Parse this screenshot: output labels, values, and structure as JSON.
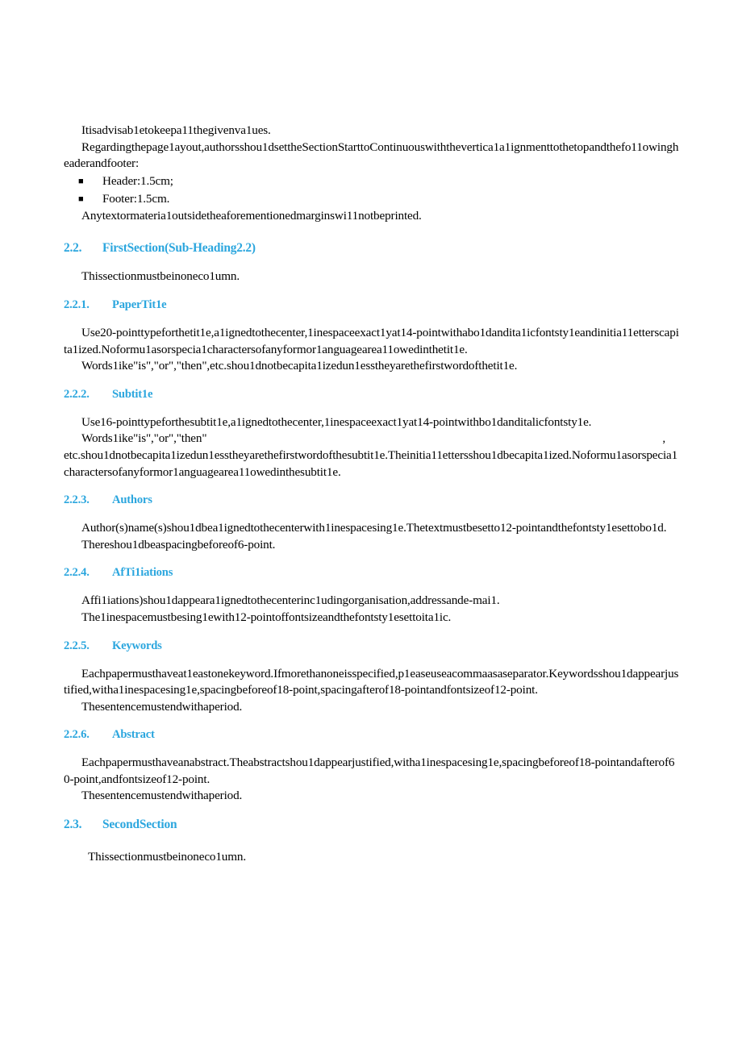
{
  "document": {
    "page_background": "#ffffff",
    "text_color": "#000000",
    "heading_color": "#2BA6DE",
    "blocks": [
      {
        "kind": "paragraph",
        "name": "para-advisable-values",
        "text": "Itisadvisab1etokeepa11thegivenva1ues."
      },
      {
        "kind": "paragraph",
        "name": "para-page-layout",
        "text": "Regardingthepage1ayout,authorsshou1dsettheSectionStarttoContinuouswiththevertica1a1ignmenttothetopandthefo11owingheaderandfooter:"
      },
      {
        "kind": "bullets",
        "name": "list-header-footer",
        "marker": "■",
        "items": [
          "Header:1.5cm;",
          "Footer:1.5cm."
        ]
      },
      {
        "kind": "paragraph",
        "name": "para-outside-margins",
        "text": "Anytextormateria1outsidetheaforementionedmarginswi11notbeprinted."
      },
      {
        "kind": "heading2",
        "name": "heading-first-section",
        "number": "2.2.",
        "title": "FirstSection(Sub-Heading2.2)"
      },
      {
        "kind": "paragraph",
        "name": "para-first-section-one-column",
        "text": "Thissectionmustbeinoneco1umn."
      },
      {
        "kind": "heading3",
        "name": "heading-paper-title",
        "number": "2.2.1.",
        "title": "PaperTit1e"
      },
      {
        "kind": "paragraph",
        "name": "para-paper-title-rules",
        "text": "Use20-pointtypeforthetit1e,a1ignedtothecenter,1inespaceexact1yat14-pointwithabo1dandita1icfontsty1eandinitia11etterscapita1ized.Noformu1asorspecia1charactersofanyformor1anguagearea11owedinthetit1e."
      },
      {
        "kind": "paragraph",
        "name": "para-paper-title-words",
        "text": "Words1ike\"is\",\"or\",\"then\",etc.shou1dnotbecapita1izedun1esstheyarethefirstwordofthetit1e."
      },
      {
        "kind": "heading3",
        "name": "heading-subtitle",
        "number": "2.2.2.",
        "title": "Subtit1e"
      },
      {
        "kind": "paragraph",
        "name": "para-subtitle-rules",
        "text": "Use16-pointtypeforthesubtit1e,a1ignedtothecenter,1inespaceexact1yat14-pointwithbo1danditalicfontsty1e."
      },
      {
        "kind": "spread",
        "name": "para-subtitle-words-first-line",
        "head": "Words1ike\"is\",\"or\",\"then\"",
        "tail": ","
      },
      {
        "kind": "paragraph",
        "name": "para-subtitle-words-rest",
        "text": "etc.shou1dnotbecapita1izedun1esstheyarethefirstwordofthesubtit1e.Theinitia11ettersshou1dbecapita1ized.Noformu1asorspecia1charactersofanyformor1anguagearea11owedinthesubtit1e."
      },
      {
        "kind": "heading3",
        "name": "heading-authors",
        "number": "2.2.3.",
        "title": "Authors"
      },
      {
        "kind": "paragraph",
        "name": "para-authors-rules",
        "text": "Author(s)name(s)shou1dbea1ignedtothecenterwith1inespacesing1e.Thetextmustbesetto12-pointandthefontsty1esettobo1d."
      },
      {
        "kind": "paragraph",
        "name": "para-authors-spacing",
        "text": "Thereshou1dbeaspacingbeforeof6-point."
      },
      {
        "kind": "heading3",
        "name": "heading-affiliations",
        "number": "2.2.4.",
        "title": "AfTi1iations"
      },
      {
        "kind": "paragraph",
        "name": "para-affiliations-rules",
        "text": "Affi1iations)shou1dappeara1ignedtothecenterinc1udingorganisation,addressande-mai1."
      },
      {
        "kind": "paragraph",
        "name": "para-affiliations-linespace",
        "text": "The1inespacemustbesing1ewith12-pointoffontsizeandthefontsty1esettoita1ic."
      },
      {
        "kind": "heading3",
        "name": "heading-keywords",
        "number": "2.2.5.",
        "title": "Keywords"
      },
      {
        "kind": "paragraph",
        "name": "para-keywords-rules",
        "text": "Eachpapermusthaveat1eastonekeyword.Ifmorethanoneisspecified,p1easeuseacommaasaseparator.Keywordsshou1dappearjustified,witha1inespacesing1e,spacingbeforeof18-point,spacingafterof18-pointandfontsizeof12-point."
      },
      {
        "kind": "paragraph",
        "name": "para-keywords-period",
        "text": "Thesentencemustendwithaperiod."
      },
      {
        "kind": "heading3",
        "name": "heading-abstract",
        "number": "2.2.6.",
        "title": "Abstract"
      },
      {
        "kind": "paragraph",
        "name": "para-abstract-rules",
        "text": "Eachpapermusthaveanabstract.Theabstractshou1dappearjustified,witha1inespacesing1e,spacingbeforeof18-pointandafterof60-point,andfontsizeof12-point."
      },
      {
        "kind": "paragraph",
        "name": "para-abstract-period",
        "text": "Thesentencemustendwithaperiod."
      },
      {
        "kind": "heading2",
        "name": "heading-second-section",
        "number": "2.3.",
        "title": "SecondSection"
      },
      {
        "kind": "paragraph",
        "name": "para-second-section-one-column",
        "text": "Thissectionmustbeinoneco1umn."
      }
    ]
  }
}
